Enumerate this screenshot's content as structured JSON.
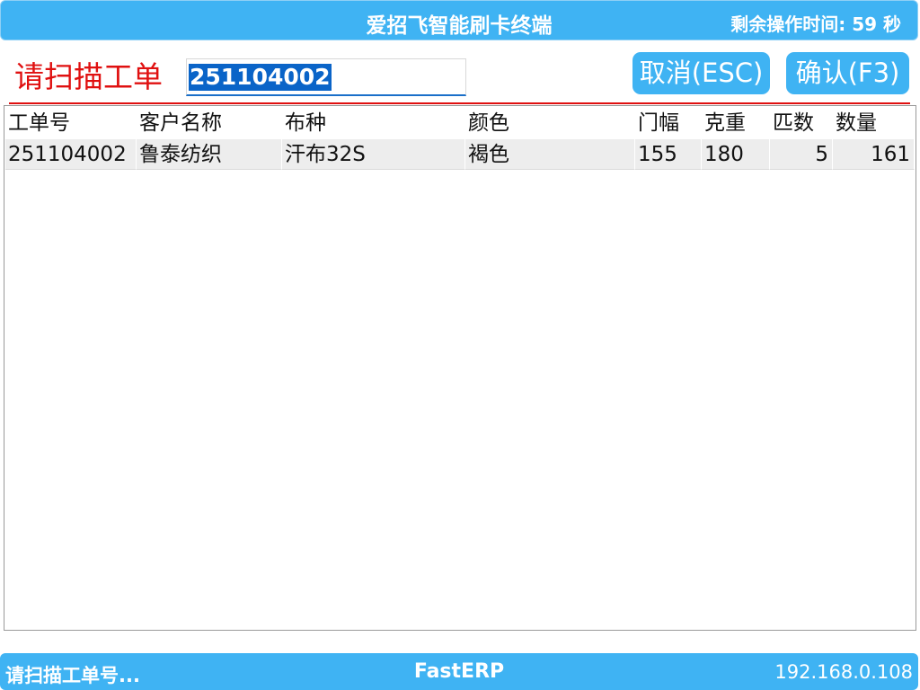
{
  "titlebar": {
    "title": "爱招飞智能刷卡终端",
    "timer": "剩余操作时间: 59 秒"
  },
  "scan": {
    "label": "请扫描工单",
    "value": "251104002"
  },
  "buttons": {
    "cancel": "取消(ESC)",
    "confirm": "确认(F3)"
  },
  "table": {
    "headers": [
      "工单号",
      "客户名称",
      "布种",
      "颜色",
      "门幅",
      "克重",
      "匹数",
      "数量"
    ],
    "rows": [
      [
        "251104002",
        "鲁泰纺织",
        "汗布32S",
        "褐色",
        "155",
        "180",
        "5",
        "161"
      ]
    ]
  },
  "statusbar": {
    "left": "请扫描工单号...",
    "center": "FastERP",
    "right": "192.168.0.108"
  },
  "colors": {
    "accent": "#3fb3f3",
    "label_red": "#e01010",
    "selection": "#0a64c8"
  }
}
